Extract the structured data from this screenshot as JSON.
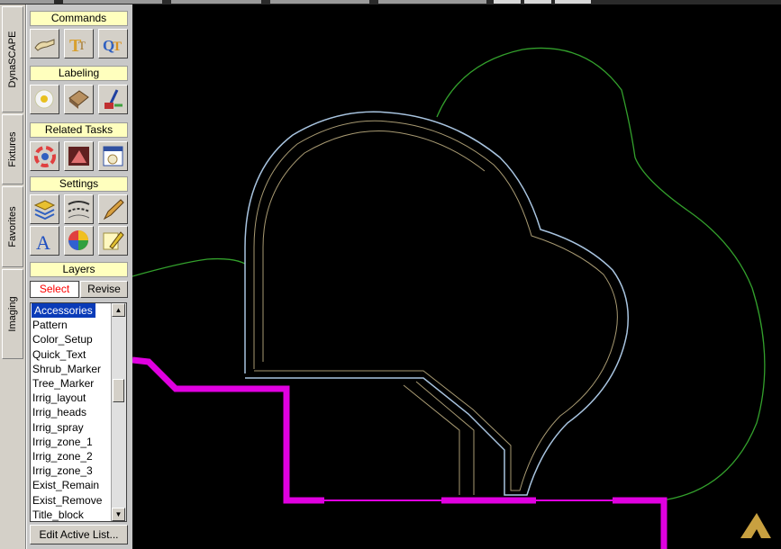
{
  "tabs": [
    {
      "label": "DynaSCAPE"
    },
    {
      "label": "Fixtures"
    },
    {
      "label": "Favorites"
    },
    {
      "label": "Imaging"
    }
  ],
  "panel": {
    "commands": {
      "title": "Commands",
      "icons": [
        "eraser-icon",
        "text-t-icon",
        "quick-text-icon"
      ]
    },
    "labeling": {
      "title": "Labeling",
      "icons": [
        "plant-label-icon",
        "material-label-icon",
        "leader-label-icon"
      ]
    },
    "related_tasks": {
      "title": "Related Tasks",
      "icons": [
        "color-wheel-icon",
        "symbol-icon",
        "calendar-plant-icon"
      ]
    },
    "settings": {
      "title": "Settings",
      "icons_row1": [
        "layers-icon",
        "line-style-icon",
        "pen-icon"
      ],
      "icons_row2": [
        "font-a-icon",
        "color-palette-icon",
        "highlighter-icon"
      ]
    },
    "layers": {
      "title": "Layers",
      "select_label": "Select",
      "revise_label": "Revise",
      "items": [
        "Accessories",
        "Pattern",
        "Color_Setup",
        "Quick_Text",
        "Shrub_Marker",
        "Tree_Marker",
        "Irrig_layout",
        "Irrig_heads",
        "Irrig_spray",
        "Irrig_zone_1",
        "Irrig_zone_2",
        "Irrig_zone_3",
        "Exist_Remain",
        "Exist_Remove",
        "Title_block"
      ],
      "selected": "Accessories",
      "edit_button": "Edit Active List..."
    }
  },
  "colors": {
    "canvas_bg": "#000000",
    "green_outline": "#33a02c",
    "pool_outline": "#a8c4e0",
    "inner_lines": "#a89a72",
    "magenta_wall": "#e000e0",
    "panel_header": "#ffffbe",
    "selection": "#0a3bb8",
    "select_text": "#ff0000",
    "logo": "#c8a040"
  }
}
